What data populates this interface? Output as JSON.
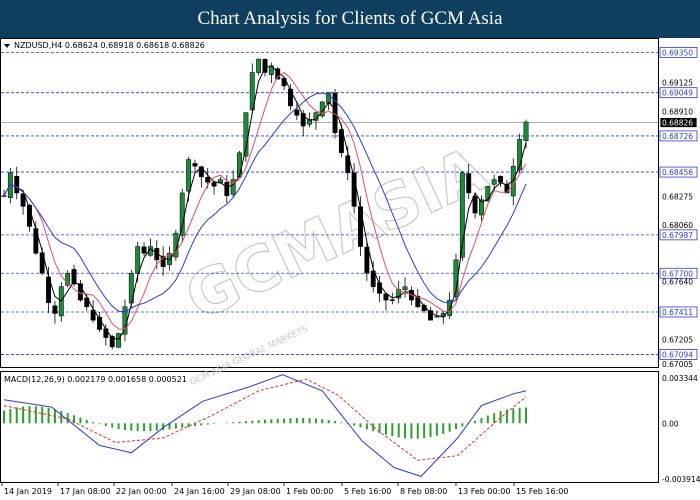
{
  "banner": {
    "title": "Chart Analysis for Clients of GCM Asia"
  },
  "chart_data": {
    "type": "candlestick",
    "symbol_header": "NZDUSD,H4  0.68624 0.68918 0.68618 0.68826",
    "price_range": [
      0.67,
      0.6945
    ],
    "price_ticks": [
      "0.69350",
      "0.69125",
      "0.69049",
      "0.68910",
      "0.68826",
      "0.68726",
      "0.68456",
      "0.68275",
      "0.68060",
      "0.67987",
      "0.67700",
      "0.67640",
      "0.67411",
      "0.67205",
      "0.67094",
      "0.67005"
    ],
    "support_resistance_levels": [
      0.6935,
      0.69049,
      0.68726,
      0.68456,
      0.67987,
      0.677,
      0.67411,
      0.67094
    ],
    "current_price": 0.68826,
    "x_labels": [
      "14 Jan 2019",
      "17 Jan 08:00",
      "22 Jan 00:00",
      "24 Jan 16:00",
      "29 Jan 08:00",
      "1 Feb 00:00",
      "5 Feb 16:00",
      "8 Feb 08:00",
      "13 Feb 00:00",
      "15 Feb 16:00"
    ],
    "close_path": [
      [
        0,
        0.6828
      ],
      [
        4,
        0.6845
      ],
      [
        8,
        0.683
      ],
      [
        12,
        0.682
      ],
      [
        16,
        0.6805
      ],
      [
        20,
        0.6785
      ],
      [
        24,
        0.677
      ],
      [
        28,
        0.6748
      ],
      [
        32,
        0.674
      ],
      [
        36,
        0.676
      ],
      [
        40,
        0.677
      ],
      [
        44,
        0.6762
      ],
      [
        48,
        0.675
      ],
      [
        52,
        0.6745
      ],
      [
        56,
        0.6735
      ],
      [
        60,
        0.6728
      ],
      [
        64,
        0.6722
      ],
      [
        68,
        0.6715
      ],
      [
        72,
        0.6725
      ],
      [
        76,
        0.6745
      ],
      [
        80,
        0.677
      ],
      [
        84,
        0.679
      ],
      [
        88,
        0.6785
      ],
      [
        92,
        0.679
      ],
      [
        96,
        0.678
      ],
      [
        100,
        0.6775
      ],
      [
        104,
        0.6785
      ],
      [
        108,
        0.68
      ],
      [
        112,
        0.683
      ],
      [
        116,
        0.6855
      ],
      [
        120,
        0.685
      ],
      [
        124,
        0.6842
      ],
      [
        128,
        0.6838
      ],
      [
        132,
        0.6835
      ],
      [
        136,
        0.684
      ],
      [
        140,
        0.6828
      ],
      [
        144,
        0.684
      ],
      [
        148,
        0.686
      ],
      [
        152,
        0.689
      ],
      [
        156,
        0.692
      ],
      [
        160,
        0.693
      ],
      [
        164,
        0.692
      ],
      [
        168,
        0.6925
      ],
      [
        172,
        0.6915
      ],
      [
        176,
        0.691
      ],
      [
        180,
        0.6895
      ],
      [
        184,
        0.6888
      ],
      [
        188,
        0.688
      ],
      [
        192,
        0.6885
      ],
      [
        196,
        0.689
      ],
      [
        200,
        0.6898
      ],
      [
        204,
        0.6905
      ],
      [
        208,
        0.6875
      ],
      [
        212,
        0.686
      ],
      [
        216,
        0.6845
      ],
      [
        220,
        0.682
      ],
      [
        224,
        0.679
      ],
      [
        228,
        0.677
      ],
      [
        232,
        0.676
      ],
      [
        236,
        0.6755
      ],
      [
        240,
        0.675
      ],
      [
        244,
        0.675
      ],
      [
        248,
        0.6758
      ],
      [
        252,
        0.676
      ],
      [
        256,
        0.675
      ],
      [
        260,
        0.6745
      ],
      [
        264,
        0.6742
      ],
      [
        268,
        0.6735
      ],
      [
        272,
        0.6738
      ],
      [
        276,
        0.674
      ],
      [
        280,
        0.675
      ],
      [
        284,
        0.678
      ],
      [
        288,
        0.6845
      ],
      [
        292,
        0.683
      ],
      [
        296,
        0.6815
      ],
      [
        300,
        0.6825
      ],
      [
        304,
        0.6835
      ],
      [
        308,
        0.684
      ],
      [
        312,
        0.6838
      ],
      [
        316,
        0.683
      ],
      [
        320,
        0.685
      ],
      [
        324,
        0.687
      ],
      [
        328,
        0.6883
      ]
    ],
    "macd": {
      "label": "MACD(12,26,9) 0.002179 0.001658 0.000521",
      "range": [
        -0.003914,
        0.003344
      ],
      "ticks": [
        "0.003344",
        "0.00",
        "-0.003914"
      ],
      "signal_path": [
        [
          0,
          0.0012
        ],
        [
          40,
          0.0003
        ],
        [
          70,
          -0.0013
        ],
        [
          100,
          -0.001
        ],
        [
          130,
          0.0005
        ],
        [
          160,
          0.0022
        ],
        [
          190,
          0.003
        ],
        [
          210,
          0.0019
        ],
        [
          235,
          -0.0005
        ],
        [
          260,
          -0.0025
        ],
        [
          285,
          -0.0022
        ],
        [
          310,
          0.0002
        ],
        [
          328,
          0.0018
        ]
      ],
      "macd_path": [
        [
          0,
          0.0016
        ],
        [
          30,
          0.0011
        ],
        [
          60,
          -0.0015
        ],
        [
          80,
          -0.002
        ],
        [
          100,
          -0.0003
        ],
        [
          125,
          0.0015
        ],
        [
          155,
          0.0025
        ],
        [
          175,
          0.0033
        ],
        [
          200,
          0.0022
        ],
        [
          225,
          -0.0012
        ],
        [
          245,
          -0.003
        ],
        [
          262,
          -0.0036
        ],
        [
          285,
          -0.001
        ],
        [
          300,
          0.0012
        ],
        [
          320,
          0.002
        ],
        [
          328,
          0.0022
        ]
      ]
    }
  },
  "watermark": {
    "text": "GCMASIA",
    "sub": "GCM ASIA GLOBAL MARKETS"
  },
  "colors": {
    "banner": "#0e3f5e",
    "ma_fast": "#e0506a",
    "ma_slow": "#2d3bd0",
    "level": "#2d3bd0",
    "hist": "#2e9e2e",
    "candle_up": "#1c8a3a"
  }
}
